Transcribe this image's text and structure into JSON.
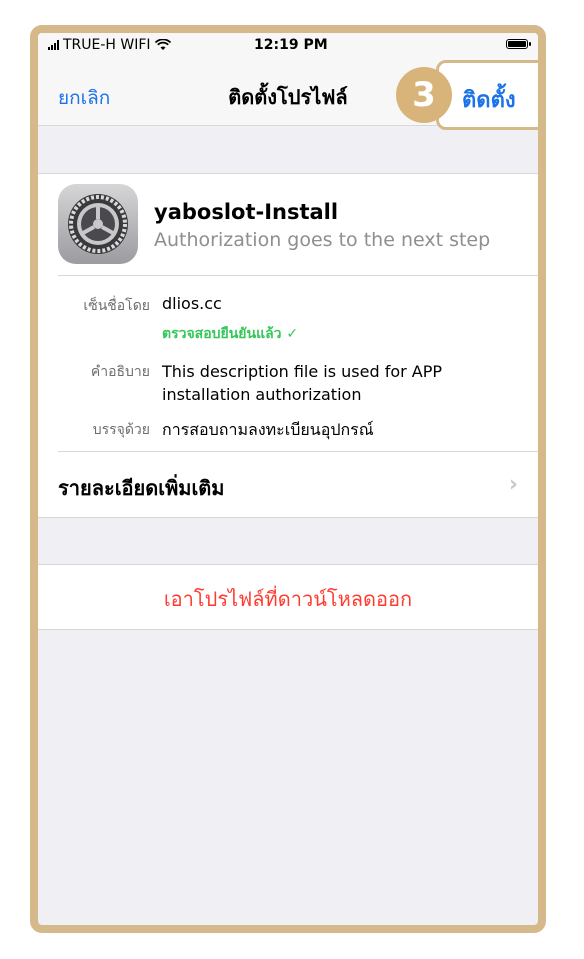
{
  "status": {
    "carrier": "TRUE-H WIFI",
    "time": "12:19 PM"
  },
  "nav": {
    "cancel": "ยกเลิก",
    "title": "ติดตั้งโปรไฟล์",
    "install": "ติดตั้ง",
    "step": "3"
  },
  "profile": {
    "name": "yaboslot-Install",
    "subtitle": "Authorization goes to the next step",
    "signed_by_label": "เซ็นชื่อโดย",
    "signed_by_value": "dlios.cc",
    "verified_text": "ตรวจสอบยืนยันแล้ว ✓",
    "description_label": "คำอธิบาย",
    "description_value": "This description file is used for APP installation authorization",
    "contains_label": "บรรจุด้วย",
    "contains_value": "การสอบถามลงทะเบียนอุปกรณ์",
    "more_details": "รายละเอียดเพิ่มเติม"
  },
  "remove_button": "เอาโปรไฟล์ที่ดาวน์โหลดออก",
  "colors": {
    "accent": "#1a73e8",
    "destructive": "#ff3b30",
    "verified": "#34c759",
    "frame": "#d6b98a"
  }
}
